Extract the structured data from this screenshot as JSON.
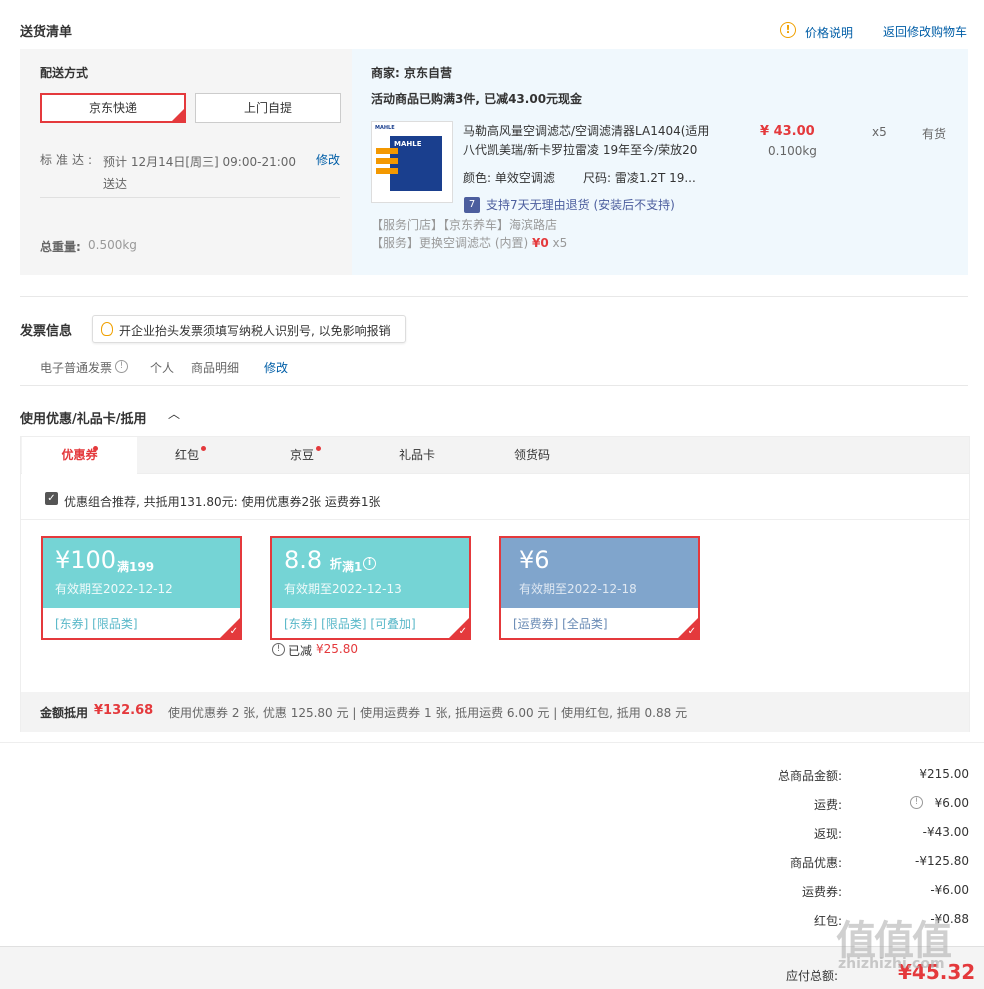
{
  "header": {
    "title": "送货清单",
    "price_note": "价格说明",
    "back_to_cart": "返回修改购物车"
  },
  "delivery": {
    "label": "配送方式",
    "option_jd": "京东快递",
    "option_self": "上门自提",
    "std_label": "标准达:",
    "std_value": "预计 12月14日[周三] 09:00-21:00 送达",
    "edit": "修改",
    "weight_label": "总重量:",
    "weight_value": "0.500kg"
  },
  "order": {
    "merchant": "商家:  京东自营",
    "promo": "活动商品已购满3件, 已减43.00元现金",
    "product_img_brand": "MAHLE",
    "product_name": "马勒高风量空调滤芯/空调滤清器LA1404(适用八代凯美瑞/新卡罗拉雷凌 19年至今/荣放20",
    "price": "¥ 43.00",
    "weight": "0.100kg",
    "qty": "x5",
    "stock": "有货",
    "color": "颜色:  单效空调滤",
    "size": "尺码:  雷凌1.2T 19...",
    "return_badge": "7",
    "return_text": "支持7天无理由退货 (安装后不支持)",
    "service1": "【服务门店】【京东养车】海滨路店",
    "service2_prefix": "【服务】更换空调滤芯 (内置)",
    "service2_price": "¥0",
    "service2_qty": "x5"
  },
  "invoice": {
    "title": "发票信息",
    "tip": "开企业抬头发票须填写纳税人识别号, 以免影响报销",
    "type": "电子普通发票",
    "q": "!",
    "personal": "个人",
    "detail": "商品明细",
    "edit": "修改"
  },
  "coupons": {
    "title": "使用优惠/礼品卡/抵用",
    "chevron": "︿",
    "tabs": [
      "优惠券",
      "红包",
      "京豆",
      "礼品卡",
      "领货码"
    ],
    "combo_text": "优惠组合推荐, 共抵用131.80元: 使用优惠券2张 运费券1张",
    "items": [
      {
        "amount": "¥100",
        "cond": "满199",
        "expiry": "有效期至2022-12-12",
        "tags": "[东券] [限品类]"
      },
      {
        "amount": "8.8",
        "unit": "折",
        "cond": "满1",
        "expiry": "有效期至2022-12-13",
        "tags": "[东券] [限品类] [可叠加]"
      },
      {
        "amount": "¥6",
        "cond": "",
        "expiry": "有效期至2022-12-18",
        "tags": "[运费券] [全品类]"
      }
    ],
    "saved_label": "已减",
    "saved_amount": "¥25.80",
    "sum_label": "金额抵用",
    "sum_amount": "¥132.68",
    "sum_detail": "使用优惠券 2 张, 优惠 125.80 元  | 使用运费券 1 张, 抵用运费 6.00 元  | 使用红包, 抵用 0.88 元"
  },
  "totals": {
    "rows": [
      {
        "label": "总商品金额:",
        "value": "¥215.00"
      },
      {
        "label": "运费:",
        "value": "¥6.00"
      },
      {
        "label": "返现:",
        "value": "-¥43.00"
      },
      {
        "label": "商品优惠:",
        "value": "-¥125.80"
      },
      {
        "label": "运费券:",
        "value": "-¥6.00"
      },
      {
        "label": "红包:",
        "value": "-¥0.88"
      }
    ],
    "pay_label": "应付总额:",
    "pay_amount": "¥45.32"
  },
  "watermark": {
    "cn": "值值值",
    "en": "zhizhizhi.com"
  },
  "colors": {
    "accent": "#e4393c",
    "link": "#005ea7",
    "coupon_teal": "#75d4d5",
    "coupon_blue": "#80a5cc"
  }
}
